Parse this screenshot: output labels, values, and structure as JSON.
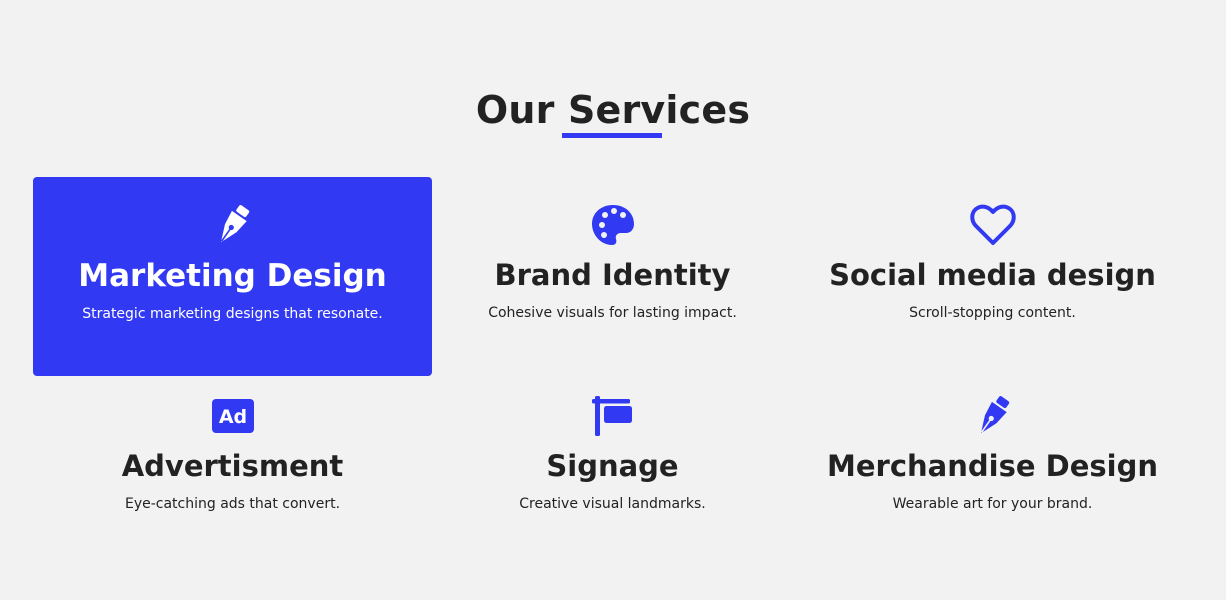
{
  "colors": {
    "accent": "#3139f3",
    "background": "#f2f2f2",
    "text": "#222222",
    "active_text": "#ffffff"
  },
  "section": {
    "title": "Our Services"
  },
  "services": [
    {
      "name": "Marketing Design",
      "description": "Strategic marketing designs that resonate.",
      "icon": "pen-nib-icon",
      "active": true
    },
    {
      "name": "Brand Identity",
      "description": "Cohesive visuals for lasting impact.",
      "icon": "palette-icon",
      "active": false
    },
    {
      "name": "Social media design",
      "description": "Scroll-stopping content.",
      "icon": "heart-icon",
      "active": false
    },
    {
      "name": "Advertisment",
      "description": "Eye-catching ads that convert.",
      "icon": "ad-icon",
      "active": false
    },
    {
      "name": "Signage",
      "description": "Creative visual landmarks.",
      "icon": "sign-icon",
      "active": false
    },
    {
      "name": "Merchandise Design",
      "description": "Wearable art for your brand.",
      "icon": "pen-nib-icon",
      "active": false
    }
  ]
}
